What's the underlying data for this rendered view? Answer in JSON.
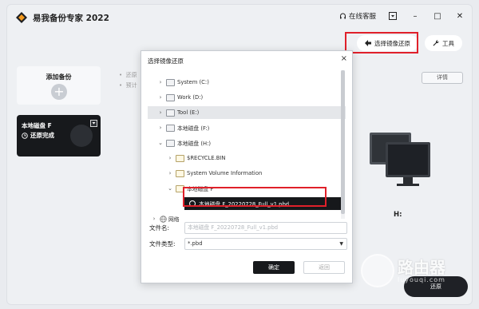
{
  "app": {
    "title": "易我备份专家 2022"
  },
  "titlebar": {
    "support_label": "在线客服",
    "minimize": "–",
    "maximize": "□",
    "close": "✕",
    "menu": "▾"
  },
  "toolbar": {
    "restore_label": "选择镜像还原",
    "tools_label": "工具"
  },
  "sidebar": {
    "add_backup_label": "添加备份",
    "card_name": "本地磁盘 F",
    "card_status": "还原完成"
  },
  "main": {
    "bullet_1": "还原",
    "bullet_2": "预计",
    "detail_label": "详情",
    "drive_label": "H:"
  },
  "dialog": {
    "title": "选择镜像还原",
    "close": "×",
    "tree": [
      {
        "label": "System (C:)",
        "type": "drive",
        "expand": "›",
        "hover": false
      },
      {
        "label": "Work (D:)",
        "type": "drive",
        "expand": "›",
        "hover": false
      },
      {
        "label": "Tool (E:)",
        "type": "drive",
        "expand": "›",
        "hover": true
      },
      {
        "label": "本地磁盘 (F:)",
        "type": "drive",
        "expand": "›",
        "hover": false
      },
      {
        "label": "本地磁盘 (H:)",
        "type": "drive",
        "expand": "⌄",
        "hover": false
      },
      {
        "label": "$RECYCLE.BIN",
        "type": "folder",
        "expand": "›",
        "hover": false
      },
      {
        "label": "System Volume Information",
        "type": "folder",
        "expand": "›",
        "hover": false
      },
      {
        "label": "本地磁盘 F",
        "type": "folder",
        "expand": "⌄",
        "hover": false
      },
      {
        "label": "本地磁盘 F_20220728_Full_v1.pbd",
        "type": "file",
        "expand": "",
        "hover": false
      },
      {
        "label": "网络",
        "type": "network",
        "expand": "›",
        "hover": false
      }
    ],
    "filename_label": "文件名:",
    "filename_value": "本地磁盘 F_20220728_Full_v1.pbd",
    "filetype_label": "文件类型:",
    "filetype_value": "*.pbd",
    "ok_label": "确定",
    "back_label": "返回"
  },
  "watermark": {
    "text": "路由器",
    "sub": "luyouqi.com"
  },
  "bottom": {
    "label": "还原"
  },
  "colors": {
    "highlight": "#e0202a",
    "dark": "#17191c"
  }
}
